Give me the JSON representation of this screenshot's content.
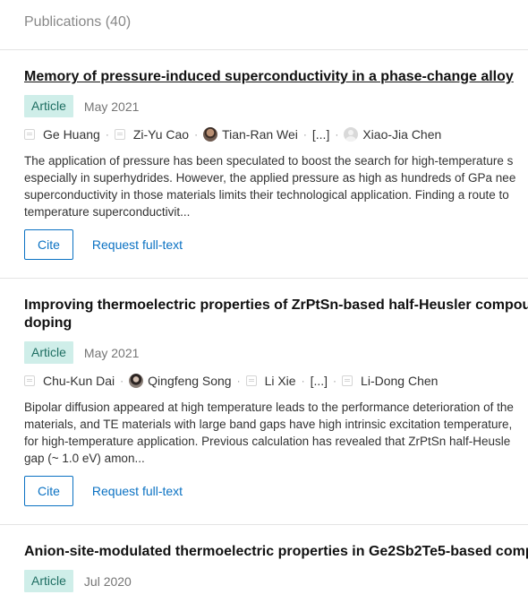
{
  "header": {
    "title": "Publications (40)"
  },
  "publications": [
    {
      "title": "Memory of pressure-induced superconductivity in a phase-change alloy",
      "type": "Article",
      "date": "May 2021",
      "authors": [
        "Ge Huang",
        "Zi-Yu Cao",
        "Tian-Ran Wei",
        "[...]",
        "Xiao-Jia Chen"
      ],
      "abstract": [
        "The application of pressure has been speculated to boost the search for high-temperature s",
        "especially in superhydrides. However, the applied pressure as high as hundreds of GPa nee",
        "superconductivity in those materials limits their technological application. Finding a route to",
        "temperature superconductivit..."
      ],
      "cite_label": "Cite",
      "fulltext_label": "Request full-text"
    },
    {
      "title": "Improving thermoelectric properties of ZrPtSn-based half-Heusler compou doping",
      "type": "Article",
      "date": "May 2021",
      "authors": [
        "Chu-Kun Dai",
        "Qingfeng Song",
        "Li Xie",
        "[...]",
        "Li-Dong Chen"
      ],
      "abstract": [
        "Bipolar diffusion appeared at high temperature leads to the performance deterioration of the",
        "materials, and TE materials with large band gaps have high intrinsic excitation temperature,",
        "for high-temperature application. Previous calculation has revealed that ZrPtSn half-Heusle",
        "gap (~ 1.0 eV) amon..."
      ],
      "cite_label": "Cite",
      "fulltext_label": "Request full-text"
    },
    {
      "title": "Anion-site-modulated thermoelectric properties in Ge2Sb2Te5-based comp",
      "type": "Article",
      "date": "Jul 2020"
    }
  ],
  "separator": "·"
}
